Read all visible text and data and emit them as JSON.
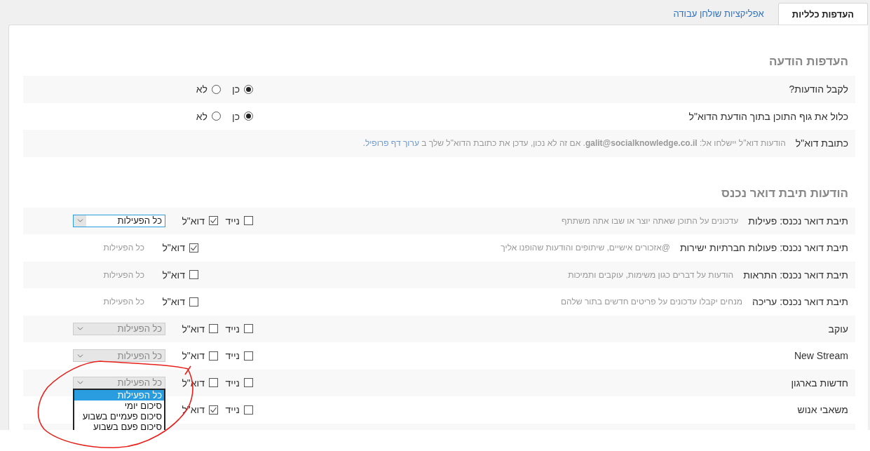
{
  "tabs": [
    {
      "label": "העדפות כלליות",
      "selected": true
    },
    {
      "label": "אפליקציות שולחן עבודה",
      "selected": false
    }
  ],
  "notification_preferences": {
    "heading": "העדפות הודעה",
    "rows": [
      {
        "kind": "radio",
        "label": "לקבל הודעות?",
        "options": [
          {
            "label": "כן",
            "selected": true
          },
          {
            "label": "לא",
            "selected": false
          }
        ]
      },
      {
        "kind": "radio",
        "label": "כלול את גוף התוכן בתוך הודעת הדוא\"ל",
        "options": [
          {
            "label": "כן",
            "selected": true
          },
          {
            "label": "לא",
            "selected": false
          }
        ]
      },
      {
        "kind": "notice",
        "label": "כתובת דוא\"ל",
        "text": "הודעות דוא\"ל יישלחו אל: **galit@socialknowledge.co.il**. אם זה לא נכון, עדכן את כתובת הדוא\"ל שלך ב",
        "link": "ערוך דף פרופיל",
        "text_after": "."
      }
    ]
  },
  "inbox_notifications": {
    "heading": "הודעות תיבת דואר נכנס",
    "rows": [
      {
        "kind": "full",
        "label": "תיבת דואר נכנס: פעילות",
        "description": "עדכונים על התוכן שאתה יוצר או שבו אתה משתתף",
        "mobile": {
          "label": "נייד",
          "checked": false
        },
        "email": {
          "label": "דוא\"ל",
          "checked": true
        },
        "frequency": {
          "value": "כל הפעילות",
          "disabled": false
        }
      },
      {
        "kind": "email_only",
        "label": "תיבת דואר נכנס: פעולות חברתיות ישירות",
        "description": "@אזכורים אישיים, שיתופים והודעות שהופנו אליך",
        "email": {
          "label": "דוא\"ל",
          "checked": true
        },
        "frequency": {
          "value": "כל הפעילות"
        }
      },
      {
        "kind": "email_only",
        "label": "תיבת דואר נכנס: התראות",
        "description": "הודעות על דברים כגון משימות, עוקבים ותמיכות",
        "email": {
          "label": "דוא\"ל",
          "checked": false
        },
        "frequency": {
          "value": "כל הפעילות"
        }
      },
      {
        "kind": "email_only",
        "label": "תיבת דואר נכנס: עריכה",
        "description": "מנחים יקבלו עדכונים על פריטים חדשים בתור שלהם",
        "email": {
          "label": "דוא\"ל",
          "checked": false
        },
        "frequency": {
          "value": "כל הפעילות"
        }
      },
      {
        "kind": "full",
        "label": "עוקב",
        "mobile": {
          "label": "נייד",
          "checked": false
        },
        "email": {
          "label": "דוא\"ל",
          "checked": false
        },
        "frequency": {
          "value": "כל הפעילות",
          "disabled": true
        }
      },
      {
        "kind": "full",
        "label": "New Stream",
        "mobile": {
          "label": "נייד",
          "checked": false
        },
        "email": {
          "label": "דוא\"ל",
          "checked": false
        },
        "frequency": {
          "value": "כל הפעילות",
          "disabled": true
        }
      },
      {
        "kind": "full",
        "label": "חדשות בארגון",
        "mobile": {
          "label": "נייד",
          "checked": false
        },
        "email": {
          "label": "דוא\"ל",
          "checked": false
        },
        "frequency": {
          "value": "כל הפעילות",
          "disabled": true,
          "expanded": true,
          "options": [
            {
              "label": "כל הפעילות",
              "selected": true
            },
            {
              "label": "סיכום יומי",
              "selected": false
            },
            {
              "label": "סיכום פעמיים בשבוע",
              "selected": false
            },
            {
              "label": "סיכום פעם בשבוע",
              "selected": false
            }
          ]
        }
      },
      {
        "kind": "full",
        "label": "משאבי אנוש",
        "mobile": {
          "label": "נייד",
          "checked": false
        },
        "email": {
          "label": "דוא\"ל",
          "checked": true
        }
      }
    ]
  }
}
